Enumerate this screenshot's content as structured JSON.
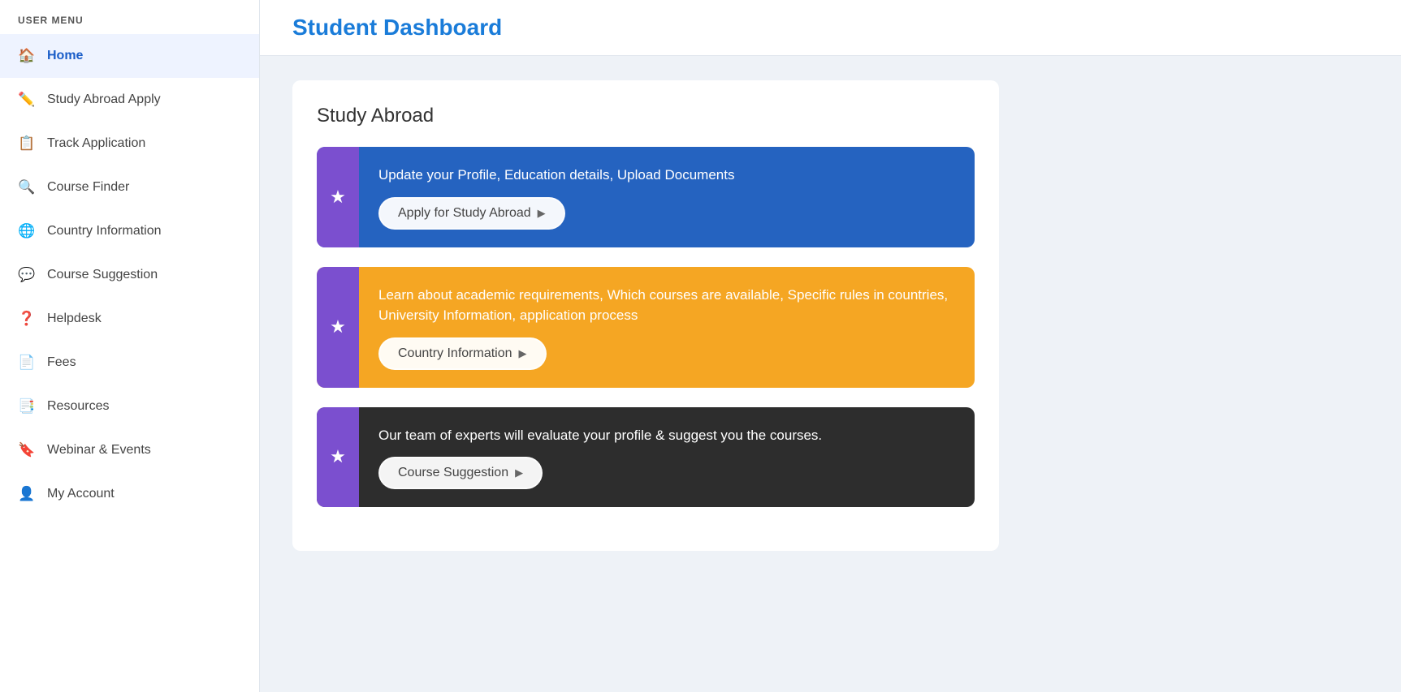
{
  "sidebar": {
    "user_menu_label": "USER MENU",
    "items": [
      {
        "id": "home",
        "label": "Home",
        "icon": "🏠",
        "active": true
      },
      {
        "id": "study-abroad-apply",
        "label": "Study Abroad Apply",
        "icon": "✏️",
        "active": false
      },
      {
        "id": "track-application",
        "label": "Track Application",
        "icon": "📋",
        "active": false
      },
      {
        "id": "course-finder",
        "label": "Course Finder",
        "icon": "🔍",
        "active": false
      },
      {
        "id": "country-information",
        "label": "Country Information",
        "icon": "🌐",
        "active": false
      },
      {
        "id": "course-suggestion",
        "label": "Course Suggestion",
        "icon": "💬",
        "active": false
      },
      {
        "id": "helpdesk",
        "label": "Helpdesk",
        "icon": "❓",
        "active": false
      },
      {
        "id": "fees",
        "label": "Fees",
        "icon": "📄",
        "active": false
      },
      {
        "id": "resources",
        "label": "Resources",
        "icon": "📑",
        "active": false
      },
      {
        "id": "webinar-events",
        "label": "Webinar & Events",
        "icon": "🔖",
        "active": false
      },
      {
        "id": "my-account",
        "label": "My Account",
        "icon": "👤",
        "active": false
      }
    ]
  },
  "header": {
    "title": "Student Dashboard"
  },
  "main": {
    "section_title": "Study Abroad",
    "cards": [
      {
        "id": "apply-card",
        "color": "blue",
        "description": "Update your Profile, Education details, Upload Documents",
        "button_label": "Apply for Study Abroad"
      },
      {
        "id": "country-card",
        "color": "orange",
        "description": "Learn about academic requirements, Which courses are available, Specific rules in countries, University Information, application process",
        "button_label": "Country Information"
      },
      {
        "id": "suggestion-card",
        "color": "dark",
        "description": "Our team of experts will evaluate your profile & suggest you the courses.",
        "button_label": "Course Suggestion"
      }
    ]
  }
}
